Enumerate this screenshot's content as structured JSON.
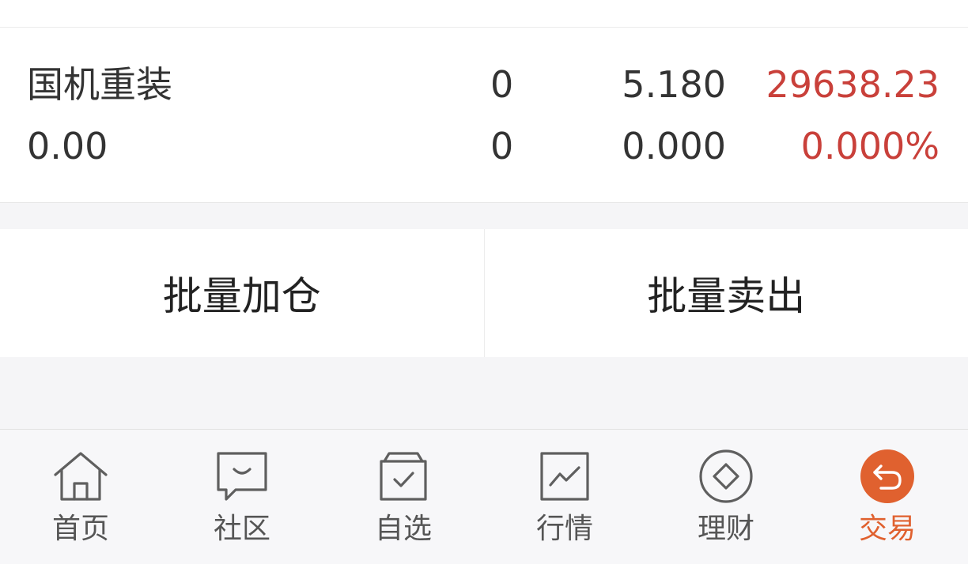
{
  "holding": {
    "name": "国机重装",
    "profit": "0.00",
    "quantity": "0",
    "available": "0",
    "price": "5.180",
    "cost": "0.000",
    "market_value": "29638.23",
    "profit_ratio": "0.000%"
  },
  "actions": {
    "add_position": "批量加仓",
    "sell_all": "批量卖出"
  },
  "tabbar": {
    "items": [
      {
        "label": "首页",
        "icon": "home-icon"
      },
      {
        "label": "社区",
        "icon": "chat-bubble-icon"
      },
      {
        "label": "自选",
        "icon": "watchlist-check-icon"
      },
      {
        "label": "行情",
        "icon": "trend-chart-icon"
      },
      {
        "label": "理财",
        "icon": "diamond-icon"
      },
      {
        "label": "交易",
        "icon": "return-arrow-icon"
      }
    ],
    "active_index": 5,
    "active_color": "#e0612f",
    "inactive_color": "#555555"
  },
  "colors": {
    "profit_red": "#c9403a"
  }
}
